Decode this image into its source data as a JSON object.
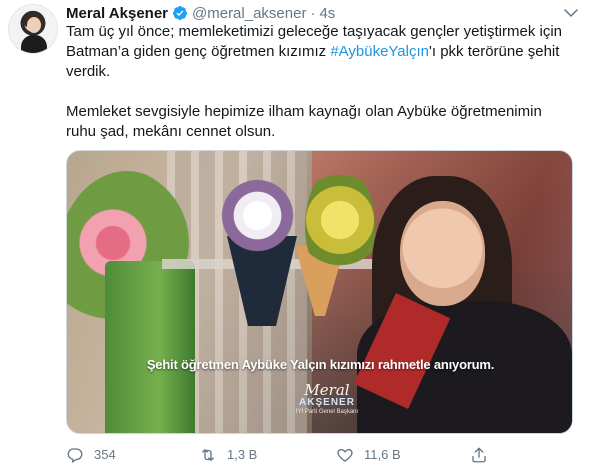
{
  "tweet": {
    "author": {
      "name": "Meral Akşener",
      "handle": "@meral_aksener",
      "dot": "·",
      "time": "4s"
    },
    "text": {
      "para1_before_hashtag": "Tam üç yıl önce; memleketimizi geleceğe taşıyacak gençler yetiştirmek için Batman’a giden genç öğretmen kızımız ",
      "hashtag": "#AybükeYalçın",
      "para1_after_hashtag": "'ı pkk terörüne şehit verdik.",
      "para2": "Memleket sevgisiyle hepimize ilham kaynağı olan Aybüke öğretmenimin ruhu şad, mekânı cennet olsun."
    },
    "media": {
      "caption": "Şehit öğretmen Aybüke Yalçın kızımızı rahmetle anıyorum.",
      "signature_script": "Meral",
      "signature_brand": "AKŞENER",
      "signature_sub": "İYİ Parti Genel Başkanı"
    },
    "actions": {
      "reply_count": "354",
      "retweet_count": "1,3 B",
      "like_count": "11,6 B"
    }
  },
  "icons": {
    "verified": "verified-badge-icon",
    "more": "chevron-down-icon",
    "reply": "reply-icon",
    "retweet": "retweet-icon",
    "like": "heart-icon",
    "share": "share-icon"
  },
  "colors": {
    "text": "#14171a",
    "muted": "#657786",
    "link": "#1b95e0",
    "verified": "#1da1f2"
  }
}
